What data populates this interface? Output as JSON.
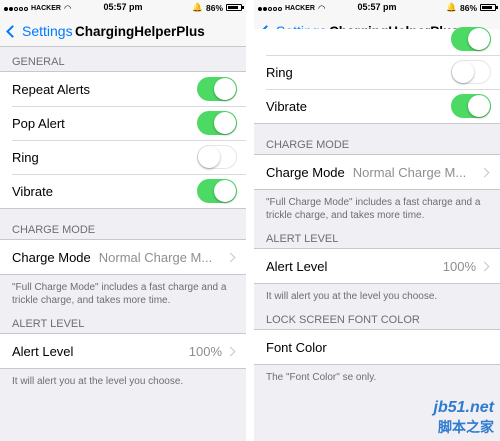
{
  "status_bar": {
    "carrier": "HACKER",
    "time": "05:57 pm",
    "battery": "86%"
  },
  "navbar": {
    "back_label": "Settings",
    "title": "ChargingHelperPlus"
  },
  "left": {
    "general_header": "GENERAL",
    "general_items": [
      {
        "label": "Repeat Alerts",
        "on": true
      },
      {
        "label": "Pop Alert",
        "on": true
      },
      {
        "label": "Ring",
        "on": false
      },
      {
        "label": "Vibrate",
        "on": true
      }
    ],
    "charge_mode_header": "CHARGE MODE",
    "charge_mode_label": "Charge Mode",
    "charge_mode_value": "Normal Charge M...",
    "charge_mode_note": "\"Full Charge Mode\" includes a fast charge and a trickle charge, and takes more time.",
    "alert_level_header": "ALERT LEVEL",
    "alert_level_label": "Alert Level",
    "alert_level_value": "100%",
    "alert_level_note": "It will alert you at the level you choose."
  },
  "right": {
    "items": [
      {
        "label": "Ring",
        "on": false
      },
      {
        "label": "Vibrate",
        "on": true
      }
    ],
    "charge_mode_header": "CHARGE MODE",
    "charge_mode_label": "Charge Mode",
    "charge_mode_value": "Normal Charge M...",
    "charge_mode_note": "\"Full Charge Mode\" includes a fast charge and a trickle charge, and takes more time.",
    "alert_level_header": "ALERT LEVEL",
    "alert_level_label": "Alert Level",
    "alert_level_value": "100%",
    "alert_level_note": "It will alert you at the level you choose.",
    "font_color_header": "LOCK SCREEN FONT COLOR",
    "font_color_label": "Font Color",
    "font_color_note": "The \"Font Color\" se only."
  },
  "watermark": {
    "url": "jb51.net",
    "text": "脚本之家"
  },
  "colors": {
    "accent": "#007aff",
    "toggle_on": "#4cd964"
  }
}
